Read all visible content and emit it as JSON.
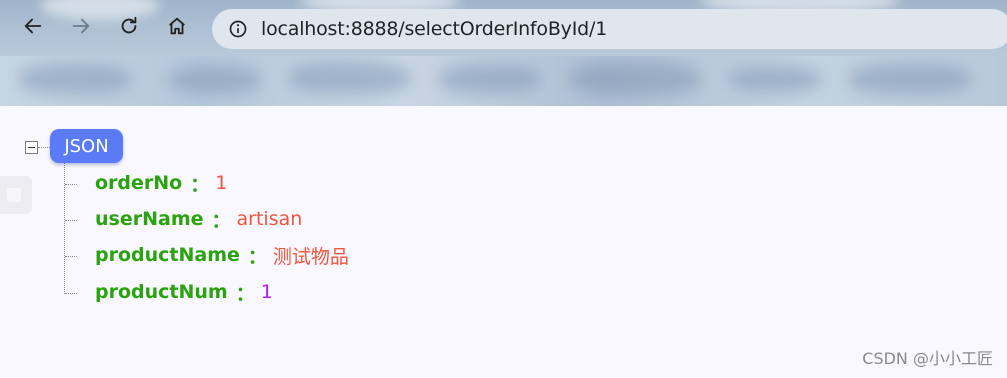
{
  "browser": {
    "url": "localhost:8888/selectOrderInfoById/1",
    "icons": {
      "back": "arrow-left-icon",
      "forward": "arrow-right-icon",
      "reload": "reload-icon",
      "home": "home-icon",
      "site_info": "info-circle-icon"
    }
  },
  "json_viewer": {
    "root_label": "JSON",
    "toggle_icon": "collapse-minus-icon",
    "fields": [
      {
        "key": "orderNo",
        "sep": "：",
        "value": "1",
        "type": "number"
      },
      {
        "key": "userName",
        "sep": "：",
        "value": "artisan",
        "type": "string"
      },
      {
        "key": "productName",
        "sep": "：",
        "value": "测试物品",
        "type": "string"
      },
      {
        "key": "productNum",
        "sep": "：",
        "value": "1",
        "type": "number"
      }
    ],
    "colors": {
      "root_badge": "#5a7bf5",
      "key": "#2aa30f",
      "string_value": "#f0553e",
      "number_value_primary": "#f0553e",
      "number_value_secondary": "#b020e8"
    }
  },
  "watermark": "CSDN @小小工匠"
}
